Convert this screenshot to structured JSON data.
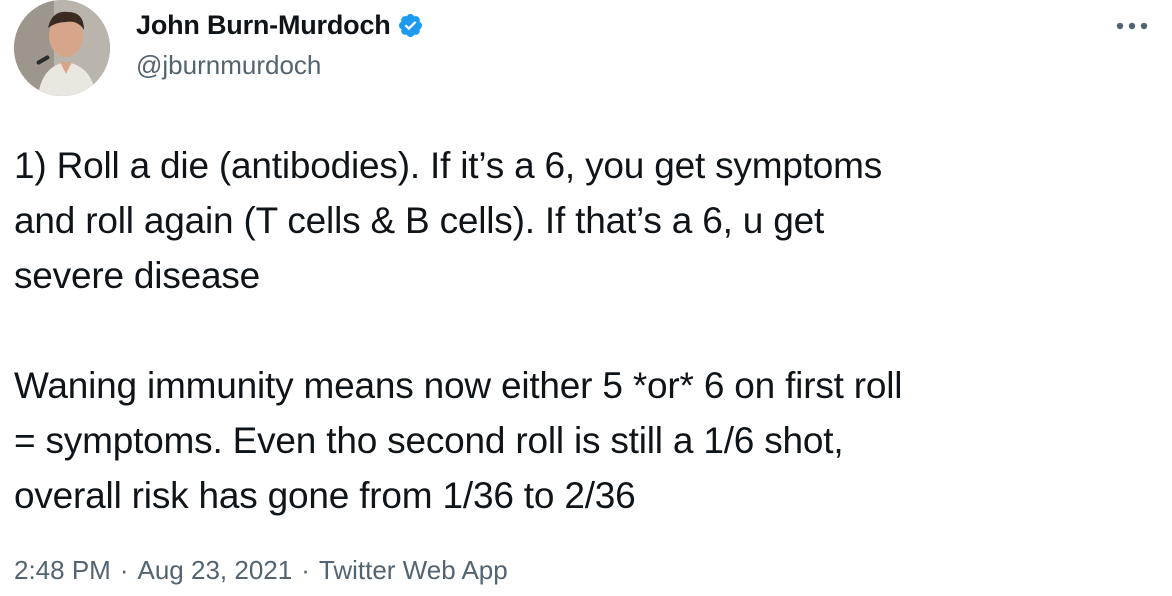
{
  "author": {
    "display_name": "John Burn-Murdoch",
    "handle": "@jburnmurdoch",
    "verified": true,
    "avatar_icon": "profile-photo",
    "verified_icon": "verified-badge-icon"
  },
  "tweet": {
    "text": "1) Roll a die (antibodies). If it’s a 6, you get symptoms\nand roll again (T cells & B cells). If that’s a 6, u get\nsevere disease\n\nWaning immunity means now either 5 *or* 6 on first roll\n= symptoms. Even tho second roll is still a 1/6 shot,\noverall risk has gone from 1/36 to 2/36"
  },
  "meta": {
    "time": "2:48 PM",
    "date": "Aug 23, 2021",
    "source": "Twitter Web App",
    "separator": "·"
  },
  "colors": {
    "text_primary": "#0f1419",
    "text_secondary": "#536471",
    "verified_blue": "#1d9bf0"
  },
  "icons": {
    "more": "more-horizontal-icon"
  }
}
